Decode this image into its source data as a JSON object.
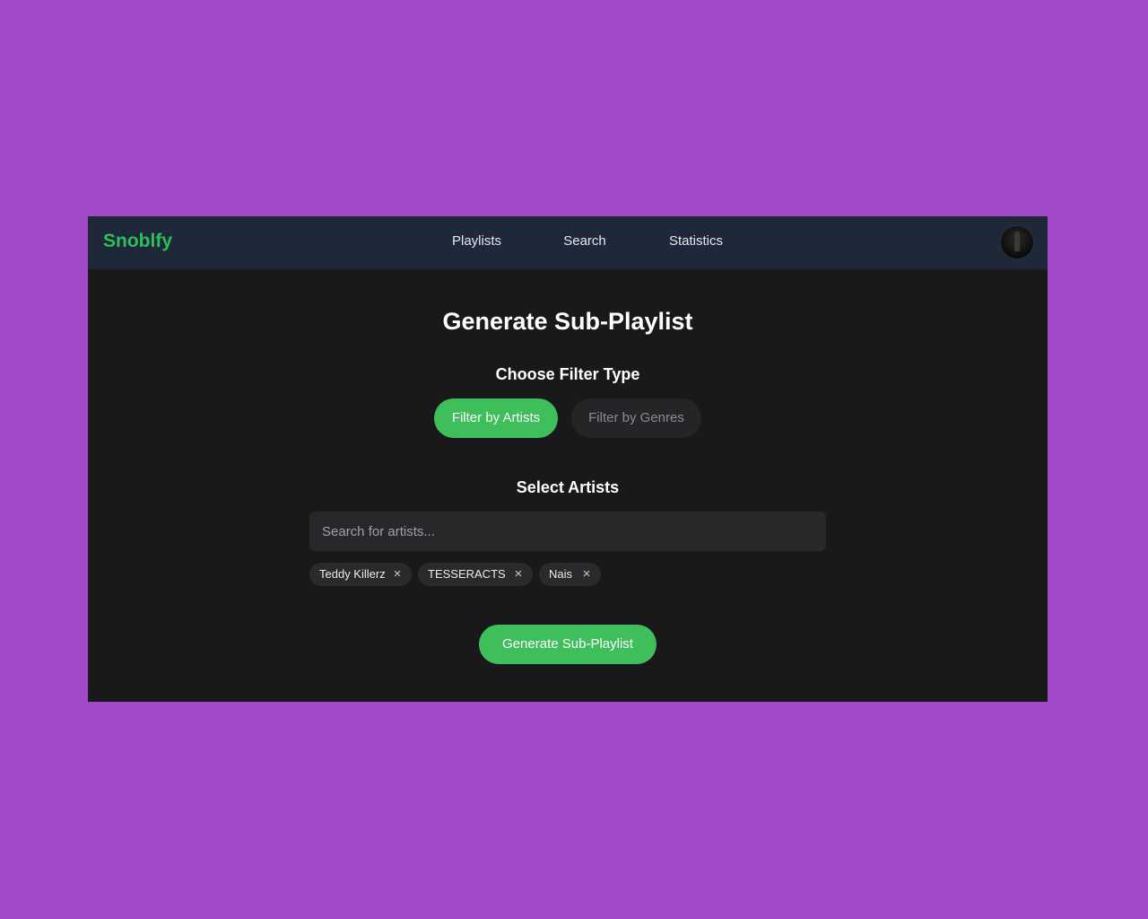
{
  "app": {
    "brand": "Snoblfy",
    "nav": [
      {
        "label": "Playlists"
      },
      {
        "label": "Search"
      },
      {
        "label": "Statistics"
      }
    ]
  },
  "main": {
    "title": "Generate Sub-Playlist",
    "filter_section_title": "Choose Filter Type",
    "filter_options": [
      {
        "label": "Filter by Artists",
        "selected": true
      },
      {
        "label": "Filter by Genres",
        "selected": false
      }
    ],
    "artists_section_title": "Select Artists",
    "search": {
      "placeholder": "Search for artists...",
      "value": ""
    },
    "selected_artists": [
      {
        "name": "Teddy Killerz",
        "remove_icon": "×"
      },
      {
        "name": "TESSERACTS",
        "remove_icon": "×"
      },
      {
        "name": "Nais",
        "remove_icon": "×"
      }
    ],
    "generate_label": "Generate Sub-Playlist"
  },
  "colors": {
    "background": "#a349c8",
    "navbar": "#1f2839",
    "panel": "#19191b",
    "accent": "#3fbe5c",
    "brand": "#2dbf5b"
  },
  "icons": {
    "chip_remove": "close-icon",
    "avatar": "user-avatar"
  }
}
